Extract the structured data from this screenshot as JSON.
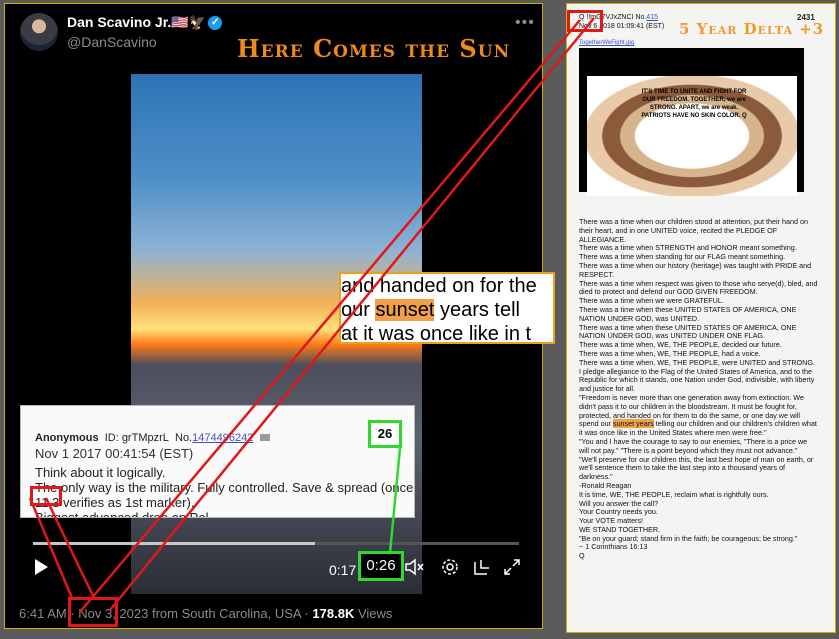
{
  "tweet": {
    "author_name": "Dan Scavino Jr.",
    "author_flags": "🇺🇸🦅",
    "verified_mark": "✓",
    "handle": "@DanScavino",
    "more_label": "•••",
    "headline": "Here Comes the Sun",
    "video": {
      "current_time": "0:17",
      "duration_box": "0:26",
      "progress": 0.58,
      "play_icon": "play-icon",
      "volume_icon": "volume-muted-icon",
      "settings_icon": "gear-icon",
      "pip_icon": "picture-in-picture-icon",
      "fullscreen_icon": "fullscreen-icon"
    },
    "footer": {
      "time": "6:41 AM",
      "date": "Nov 3, 2023",
      "location": " from South Carolina, USA",
      "sep": " · ",
      "views_count": "178.8K",
      "views_label": " Views"
    }
  },
  "crop_text": {
    "line1": "and handed on for the",
    "line2_pre": " our ",
    "line2_hl": "sunset",
    "line2_post": " years tell",
    "line3": "at it was once like in t"
  },
  "anon_post": {
    "name": "Anonymous",
    "id_label": "ID:",
    "id": "grTMpzrL",
    "no_label": "No.",
    "number": "1474496242",
    "date": "Nov 1 2017 00:41:54 (EST)",
    "count": "26",
    "line1": "Think about it logically.",
    "line2": "The only way is the military. Fully controlled. Save & spread (once",
    "line3_num": "11.3",
    "line3_rest": " verifies as 1st marker).",
    "line4": "Biggest advanced drop on Pol."
  },
  "q_post": {
    "header": "Q !!mG7VJxZNCI No.",
    "post_no": "415",
    "date": "Nov 6 2018 01:09:41 (EST)",
    "count": "2431",
    "delta_label": "5 Year Delta",
    "delta_plus": " +3",
    "filename": "TogetherWeFight.jpg",
    "image_text": "IT'S TIME TO UNITE AND FIGHT FOR OUR FREEDOM. TOGETHER, we are STRONG. APART, we are weak. PATRIOTS HAVE NO SKIN COLOR. Q",
    "body_pre": [
      "There was a time when our children stood at attention, put their hand on their heart, and in one UNITED voice, recited the PLEDGE OF ALLEGIANCE.",
      "There was a time when STRENGTH and HONOR meant something.",
      "There was a time when standing for our FLAG meant something.",
      "There was a time when our history (heritage) was taught with PRIDE and RESPECT.",
      "There was a time when respect was given to those who serve(d), bled, and died to protect and defend our GOD GIVEN FREEDOM.",
      "There was a time when we were GRATEFUL.",
      "There was a time when these UNITED STATES OF AMERICA, ONE NATION UNDER GOD, was UNITED.",
      "There was a time when these UNITED STATES OF AMERICA, ONE NATION UNDER GOD, was UNITED UNDER ONE FLAG.",
      "There was a time when, WE, THE PEOPLE, decided our future.",
      "There was a time when, WE, THE PEOPLE, had a voice.",
      "There was a time when, WE, THE PEOPLE, were UNITED and STRONG.",
      "I pledge allegiance to the Flag of the United States of America, and to the Republic for which it stands, one Nation under God, indivisible, with liberty and justice for all."
    ],
    "quote_pre": "\"Freedom is never more than one generation away from extinction. We didn't pass it to our children in the bloodstream. It must be fought for, protected, and handed on for them to do the same, or one day we will spend our ",
    "quote_hl": "sunset years",
    "quote_post": " telling our children and our children's children what it was once like in the United States where men were free.\"",
    "body_post": [
      "\"You and I have the courage to say to our enemies, \"There is a price we will not pay.\" \"There is a point beyond which they must not advance.\"",
      "\"We'll preserve for our children this, the last best hope of man on earth, or we'll sentence them to take the last step into a thousand years of darkness.\"",
      "-Ronald Reagan",
      "It is time, WE, THE PEOPLE, reclaim what is rightfully ours.",
      "Will you answer the call?",
      "Your Country needs you.",
      "Your VOTE matters!",
      "WE STAND TOGETHER.",
      "\"Be on your guard; stand firm in the faith; be courageous; be strong.\"",
      "~ 1 Corinthians 16:13",
      "Q"
    ]
  },
  "colors": {
    "highlight_red": "#e01818",
    "highlight_green": "#2fd82f",
    "headline_orange": "#ef8a1a",
    "sunset_highlight": "#f0a04a"
  }
}
